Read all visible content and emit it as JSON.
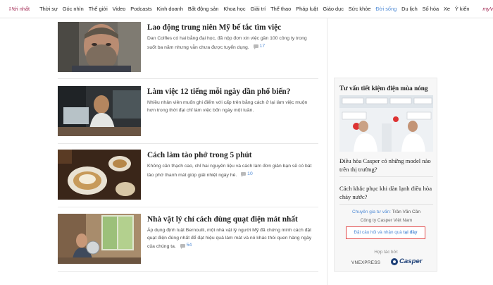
{
  "nav": {
    "latest": "Mới nhất",
    "items": [
      "Thời sự",
      "Góc nhìn",
      "Thế giới",
      "Video",
      "Podcasts",
      "Kinh doanh",
      "Bất động sản",
      "Khoa học",
      "Giải trí",
      "Thể thao",
      "Pháp luật",
      "Giáo dục",
      "Sức khỏe",
      "Đời sống",
      "Du lịch",
      "Số hóa",
      "Xe",
      "Ý kiến"
    ],
    "active": "Đời sống",
    "myvne": "myVnE"
  },
  "articles": [
    {
      "title": "Lao động trung niên Mỹ bế tắc tìm việc",
      "desc": "Dan Colfles có hai bằng đại học, đã nộp đơn xin việc gần 100 công ty trong suốt ba năm nhưng vẫn chưa được tuyển dụng.",
      "comments": "17"
    },
    {
      "title": "Làm việc 12 tiếng mỗi ngày dần phổ biến?",
      "desc": "Nhiều nhân viên muốn ghi điểm với cấp trên bằng cách ở lại làm việc muộn hơn trong thời đại chỉ làm việc bốn ngày một tuần.",
      "comments": ""
    },
    {
      "title": "Cách làm tào phớ trong 5 phút",
      "desc": "Không cần thạch cao, chỉ hai nguyên liệu và cách làm đơn giản bạn sẽ có bát tào phớ thanh mát giúp giải nhiệt ngày hè.",
      "comments": "10"
    },
    {
      "title": "Nhà vật lý chỉ cách dùng quạt điện mát nhất",
      "desc": "Áp dụng định luật Bernoulli, một nhà vật lý người Mỹ đã chứng minh cách đặt quạt điện đúng nhất để đạt hiệu quả làm mát và nó khác thói quen hàng ngày của chúng ta.",
      "comments": "54"
    }
  ],
  "sidebar": {
    "title": "Tư vấn tiết kiệm điện mùa nóng",
    "q1": "Điều hòa Casper có những model nào trên thị trường?",
    "q2": "Cách khắc phục khi dàn lạnh điều hòa chảy nước?",
    "expert_label": "Chuyên gia tư vấn:",
    "expert_name": "Trần Văn Cần",
    "company": "Công ty Casper Việt Nam",
    "ask_text": "Đặt câu hỏi và nhận quà",
    "ask_link": "tại đây",
    "partner_label": "Hợp tác bởi:",
    "logo_vne": "VNEXPRESS",
    "logo_casper": "Casper"
  }
}
